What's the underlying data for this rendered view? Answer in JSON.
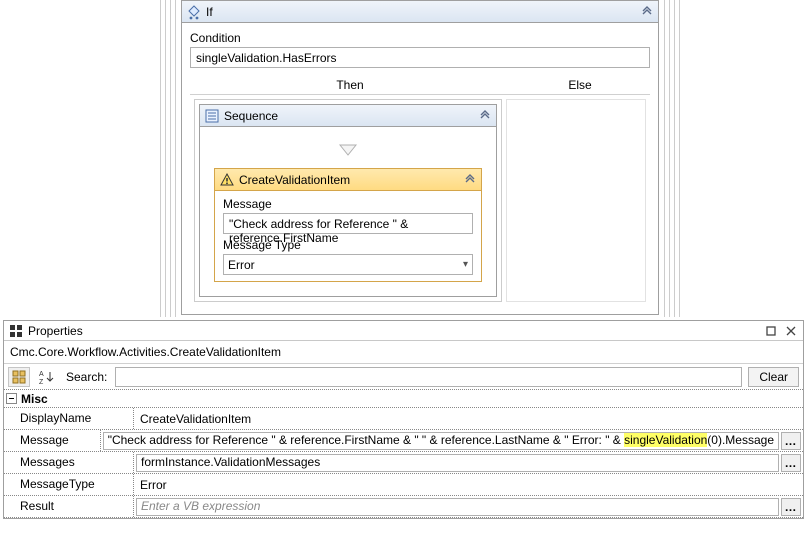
{
  "if": {
    "title": "If",
    "conditionLabel": "Condition",
    "conditionValue": "singleValidation.HasErrors",
    "thenLabel": "Then",
    "elseLabel": "Else"
  },
  "sequence": {
    "title": "Sequence"
  },
  "cvi": {
    "title": "CreateValidationItem",
    "messageLabel": "Message",
    "messageValue": "\"Check address for Reference \" & reference.FirstName",
    "messageTypeLabel": "Message Type",
    "messageTypeValue": "Error"
  },
  "props": {
    "header": "Properties",
    "path": "Cmc.Core.Workflow.Activities.CreateValidationItem",
    "searchLabel": "Search:",
    "clearLabel": "Clear",
    "category": "Misc",
    "rows": {
      "displayName": {
        "name": "DisplayName",
        "value": "CreateValidationItem"
      },
      "message": {
        "name": "Message",
        "prefix": "\"Check address for Reference \" & reference.FirstName & \" \" & reference.LastName & \" Error: \" & ",
        "hl": "singleValidation",
        "suffix": "(0).Message"
      },
      "messages": {
        "name": "Messages",
        "value": "formInstance.ValidationMessages"
      },
      "messageType": {
        "name": "MessageType",
        "value": "Error"
      },
      "result": {
        "name": "Result",
        "placeholder": "Enter a VB expression"
      }
    },
    "ellipsis": "…",
    "catToggle": "–"
  }
}
